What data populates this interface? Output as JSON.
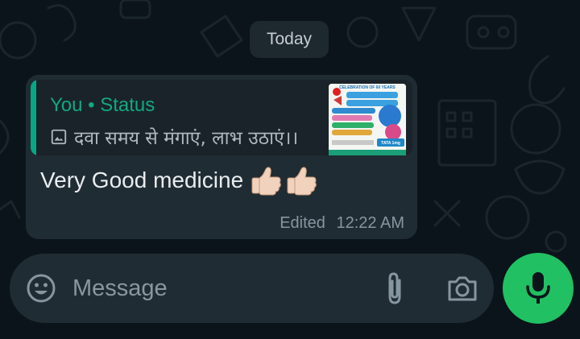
{
  "chat": {
    "date_divider": "Today",
    "message": {
      "quote": {
        "sender": "You • Status",
        "caption": "दवा समय से मंगाएं, लाभ उठाएं।।",
        "thumbnail_icon": "photo-icon",
        "thumbnail": {
          "banner": "CELEBRATION OF 60 YEARS",
          "brand": "TATA 1mg"
        }
      },
      "text": "Very Good medicine",
      "emojis": [
        "thumbs-up-icon",
        "thumbs-up-icon"
      ],
      "edited_label": "Edited",
      "time": "12:22 AM"
    }
  },
  "composer": {
    "placeholder": "Message",
    "emoji_icon": "smiley-icon",
    "attach_icon": "paperclip-icon",
    "camera_icon": "camera-icon",
    "mic_icon": "mic-icon"
  },
  "colors": {
    "background": "#0b141a",
    "bubble": "#202c33",
    "quote_bg": "#1a2329",
    "accent_green": "#06a884",
    "mic_button": "#21c063",
    "text_primary": "#e9edef",
    "text_secondary": "#8696a0"
  }
}
